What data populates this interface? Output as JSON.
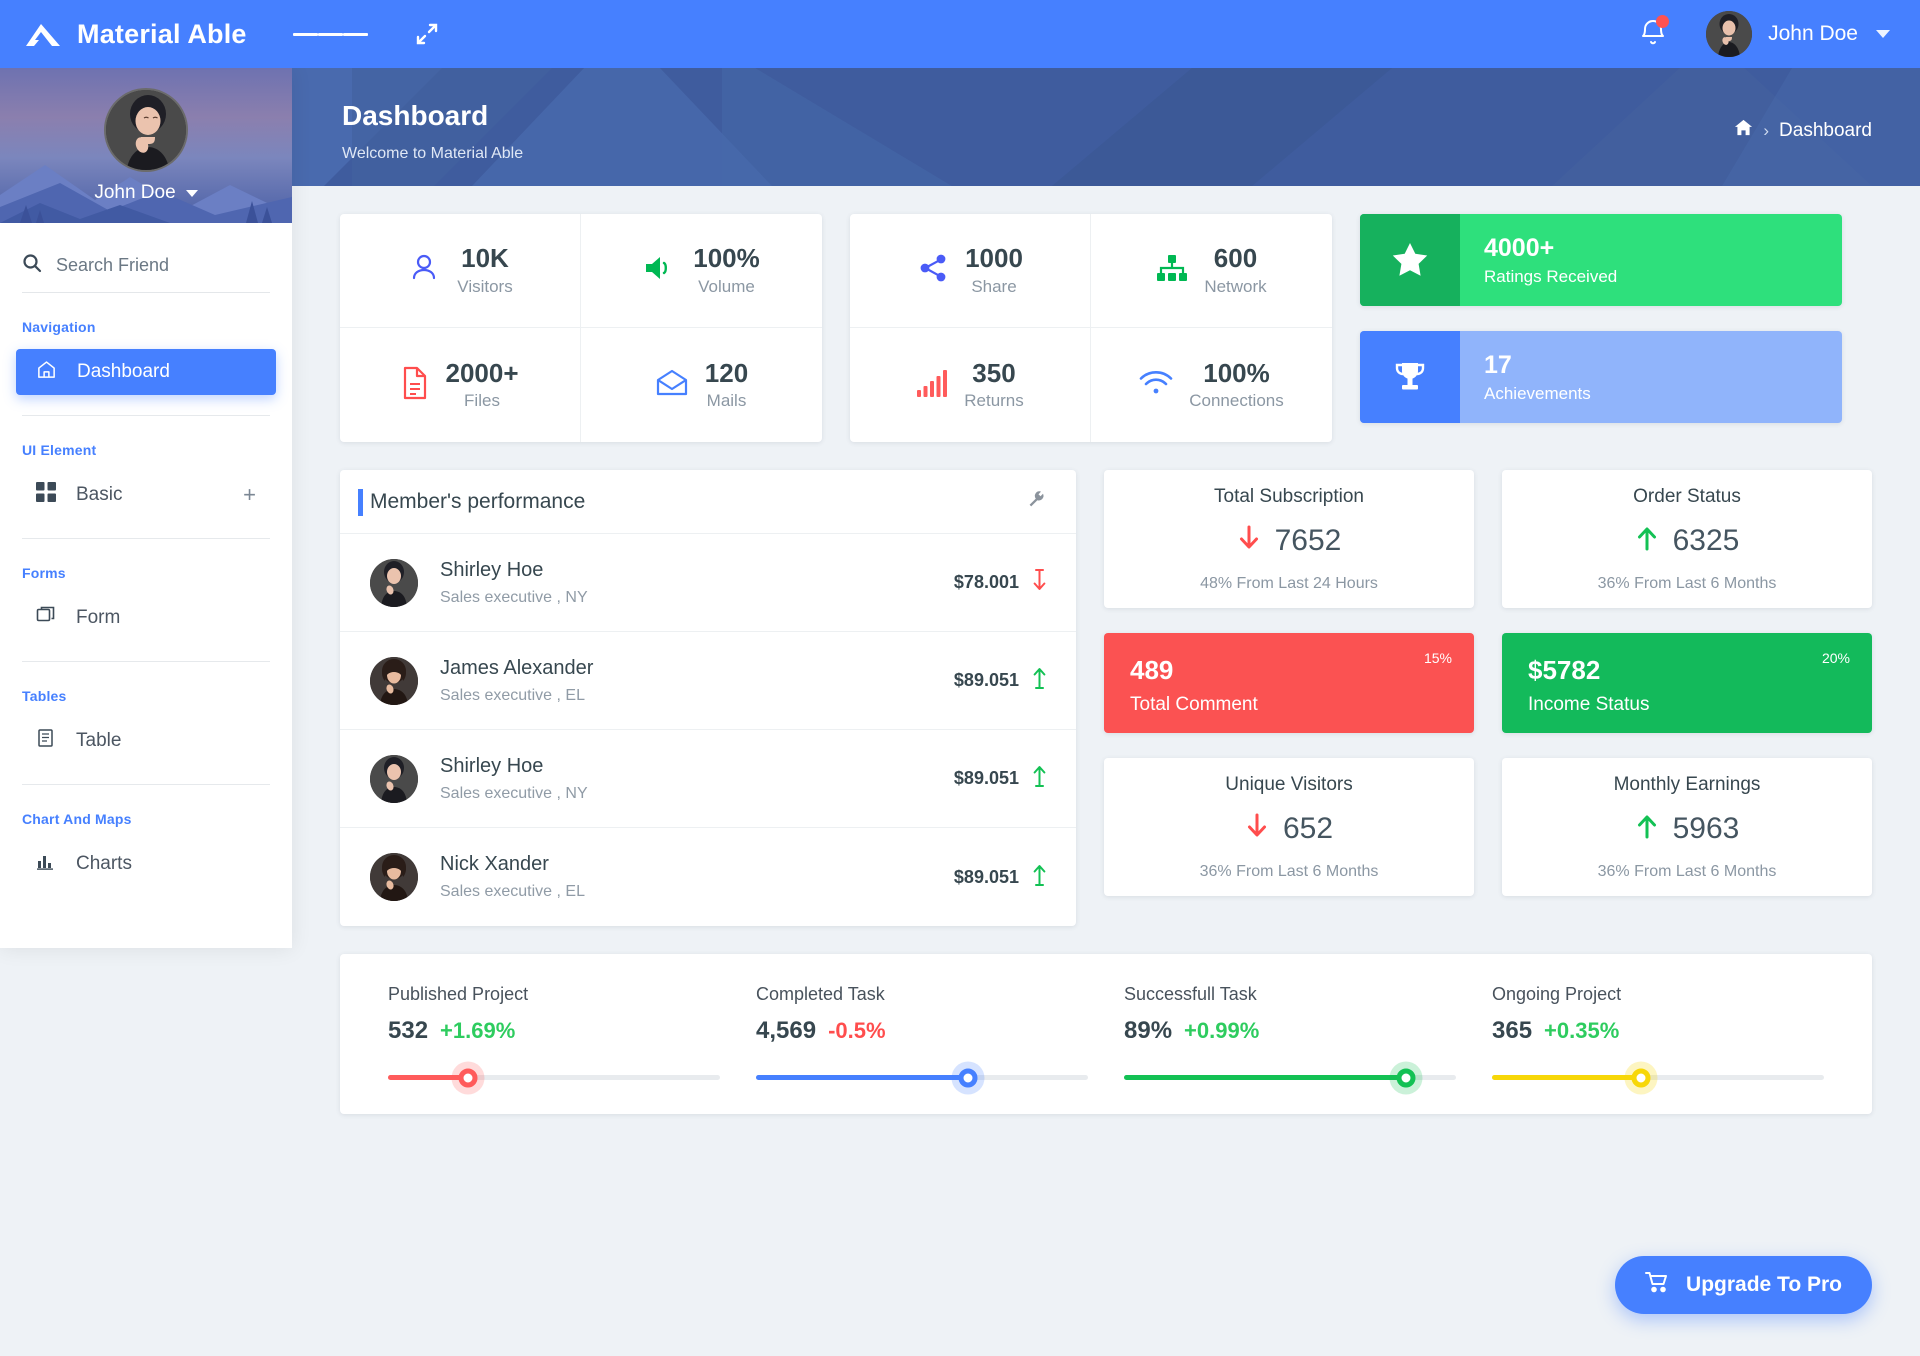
{
  "topbar": {
    "brand": "Material Able",
    "user_name": "John Doe",
    "menu_icon": "hamburger-icon",
    "expand_icon": "expand-icon",
    "bell_icon": "bell-icon"
  },
  "sidebar": {
    "profile_name": "John Doe",
    "search_placeholder": "Search Friend",
    "sections": [
      {
        "caption": "Navigation",
        "items": [
          {
            "label": "Dashboard",
            "icon": "home-icon",
            "active": true
          }
        ]
      },
      {
        "caption": "UI Element",
        "items": [
          {
            "label": "Basic",
            "icon": "grid-icon",
            "active": false,
            "expand": "+"
          }
        ]
      },
      {
        "caption": "Forms",
        "items": [
          {
            "label": "Form",
            "icon": "copy-icon",
            "active": false
          }
        ]
      },
      {
        "caption": "Tables",
        "items": [
          {
            "label": "Table",
            "icon": "table-icon",
            "active": false
          }
        ]
      },
      {
        "caption": "Chart And Maps",
        "items": [
          {
            "label": "Charts",
            "icon": "bar-chart-icon",
            "active": false
          }
        ]
      }
    ]
  },
  "banner": {
    "title": "Dashboard",
    "subtitle": "Welcome to Material Able",
    "breadcrumb_home_icon": "home-icon",
    "breadcrumb_separator": "›",
    "breadcrumb_current": "Dashboard"
  },
  "stats_group_1": [
    {
      "value": "10K",
      "label": "Visitors",
      "icon": "user-icon",
      "color": "#4a5bf7"
    },
    {
      "value": "100%",
      "label": "Volume",
      "icon": "volume-icon",
      "color": "#00b853"
    },
    {
      "value": "2000+",
      "label": "Files",
      "icon": "file-icon",
      "color": "#ff4d4d"
    },
    {
      "value": "120",
      "label": "Mails",
      "icon": "mail-icon",
      "color": "#4680ff"
    }
  ],
  "stats_group_2": [
    {
      "value": "1000",
      "label": "Share",
      "icon": "share-icon",
      "color": "#4a5bf7"
    },
    {
      "value": "600",
      "label": "Network",
      "icon": "network-icon",
      "color": "#00b853"
    },
    {
      "value": "350",
      "label": "Returns",
      "icon": "bars-icon",
      "color": "#ff5b5b"
    },
    {
      "value": "100%",
      "label": "Connections",
      "icon": "wifi-icon",
      "color": "#4680ff"
    }
  ],
  "achievements": [
    {
      "value": "4000+",
      "label": "Ratings Received",
      "icon": "star-icon",
      "icon_bg": "#16b15d",
      "bg": "#2ee07c"
    },
    {
      "value": "17",
      "label": "Achievements",
      "icon": "trophy-icon",
      "icon_bg": "#4680ff",
      "bg": "#90b4fb"
    }
  ],
  "members": {
    "title": "Member's performance",
    "settings_icon": "wrench-icon",
    "rows": [
      {
        "name": "Shirley Hoe",
        "role": "Sales executive , NY",
        "amount": "$78.001",
        "trend": "down",
        "trend_color": "#ff4d4d"
      },
      {
        "name": "James Alexander",
        "role": "Sales executive , EL",
        "amount": "$89.051",
        "trend": "up",
        "trend_color": "#13c154"
      },
      {
        "name": "Shirley Hoe",
        "role": "Sales executive , NY",
        "amount": "$89.051",
        "trend": "up",
        "trend_color": "#13c154"
      },
      {
        "name": "Nick Xander",
        "role": "Sales executive , EL",
        "amount": "$89.051",
        "trend": "up",
        "trend_color": "#13c154"
      }
    ]
  },
  "metrics": [
    {
      "title": "Total Subscription",
      "value": "7652",
      "sub": "48% From Last 24 Hours",
      "trend": "down",
      "trend_color": "#ff4d4d"
    },
    {
      "title": "Order Status",
      "value": "6325",
      "sub": "36% From Last 6 Months",
      "trend": "up",
      "trend_color": "#13c154"
    },
    {
      "title": "Unique Visitors",
      "value": "652",
      "sub": "36% From Last 6 Months",
      "trend": "down",
      "trend_color": "#ff4d4d"
    },
    {
      "title": "Monthly Earnings",
      "value": "5963",
      "sub": "36% From Last 6 Months",
      "trend": "up",
      "trend_color": "#13c154"
    }
  ],
  "tiles": [
    {
      "value": "489",
      "label": "Total Comment",
      "pct": "15%",
      "bg": "#fb5252"
    },
    {
      "value": "$5782",
      "label": "Income Status",
      "pct": "20%",
      "bg": "#13ba5b"
    }
  ],
  "sliders": [
    {
      "title": "Published Project",
      "value": "532",
      "delta": "+1.69%",
      "delta_color": "#2ecc5f",
      "fill_color": "#ff5b5b",
      "percent": 24
    },
    {
      "title": "Completed Task",
      "value": "4,569",
      "delta": "-0.5%",
      "delta_color": "#ff4d4d",
      "fill_color": "#4680ff",
      "percent": 64
    },
    {
      "title": "Successfull Task",
      "value": "89%",
      "delta": "+0.99%",
      "delta_color": "#2ecc5f",
      "fill_color": "#13c154",
      "percent": 85
    },
    {
      "title": "Ongoing Project",
      "value": "365",
      "delta": "+0.35%",
      "delta_color": "#2ecc5f",
      "fill_color": "#f7d708",
      "percent": 45
    }
  ],
  "upgrade": {
    "label": "Upgrade To Pro",
    "icon": "cart-icon"
  }
}
